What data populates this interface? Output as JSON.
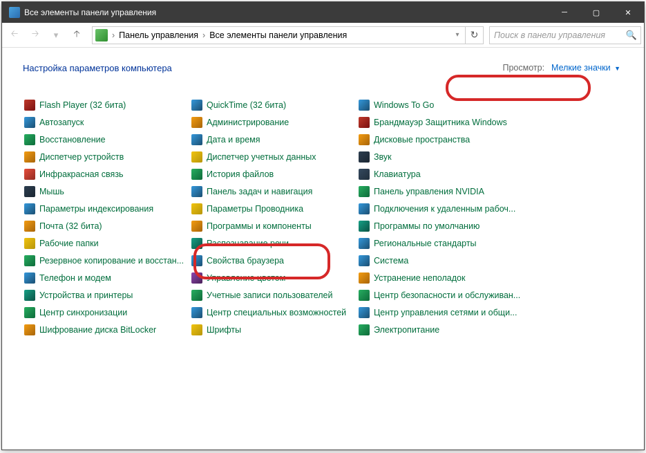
{
  "titlebar": {
    "text": "Все элементы панели управления"
  },
  "breadcrumb": {
    "root": "Панель управления",
    "current": "Все элементы панели управления"
  },
  "search": {
    "placeholder": "Поиск в панели управления"
  },
  "header": {
    "title": "Настройка параметров компьютера",
    "view_label": "Просмотр:",
    "view_value": "Мелкие значки"
  },
  "columns": [
    [
      {
        "label": "Flash Player (32 бита)",
        "icon": "flash-icon",
        "cls": "ic-a"
      },
      {
        "label": "Автозапуск",
        "icon": "autoplay-icon",
        "cls": "ic-b"
      },
      {
        "label": "Восстановление",
        "icon": "recovery-icon",
        "cls": "ic-c"
      },
      {
        "label": "Диспетчер устройств",
        "icon": "device-manager-icon",
        "cls": "ic-d"
      },
      {
        "label": "Инфракрасная связь",
        "icon": "infrared-icon",
        "cls": "ic-g"
      },
      {
        "label": "Мышь",
        "icon": "mouse-icon",
        "cls": "ic-h"
      },
      {
        "label": "Параметры индексирования",
        "icon": "indexing-icon",
        "cls": "ic-b"
      },
      {
        "label": "Почта (32 бита)",
        "icon": "mail-icon",
        "cls": "ic-d"
      },
      {
        "label": "Рабочие папки",
        "icon": "work-folders-icon",
        "cls": "ic-i"
      },
      {
        "label": "Резервное копирование и восстан...",
        "icon": "backup-icon",
        "cls": "ic-c"
      },
      {
        "label": "Телефон и модем",
        "icon": "phone-modem-icon",
        "cls": "ic-b"
      },
      {
        "label": "Устройства и принтеры",
        "icon": "devices-printers-icon",
        "cls": "ic-f"
      },
      {
        "label": "Центр синхронизации",
        "icon": "sync-center-icon",
        "cls": "ic-c"
      },
      {
        "label": "Шифрование диска BitLocker",
        "icon": "bitlocker-icon",
        "cls": "ic-d"
      }
    ],
    [
      {
        "label": "QuickTime (32 бита)",
        "icon": "quicktime-icon",
        "cls": "ic-b"
      },
      {
        "label": "Администрирование",
        "icon": "admin-tools-icon",
        "cls": "ic-d"
      },
      {
        "label": "Дата и время",
        "icon": "date-time-icon",
        "cls": "ic-b"
      },
      {
        "label": "Диспетчер учетных данных",
        "icon": "credential-manager-icon",
        "cls": "ic-i"
      },
      {
        "label": "История файлов",
        "icon": "file-history-icon",
        "cls": "ic-c"
      },
      {
        "label": "Панель задач и навигация",
        "icon": "taskbar-icon",
        "cls": "ic-b"
      },
      {
        "label": "Параметры Проводника",
        "icon": "explorer-options-icon",
        "cls": "ic-i"
      },
      {
        "label": "Программы и компоненты",
        "icon": "programs-features-icon",
        "cls": "ic-d"
      },
      {
        "label": "Распознавание речи",
        "icon": "speech-icon",
        "cls": "ic-f"
      },
      {
        "label": "Свойства браузера",
        "icon": "internet-options-icon",
        "cls": "ic-b"
      },
      {
        "label": "Управление цветом",
        "icon": "color-management-icon",
        "cls": "ic-e"
      },
      {
        "label": "Учетные записи пользователей",
        "icon": "user-accounts-icon",
        "cls": "ic-c"
      },
      {
        "label": "Центр специальных возможностей",
        "icon": "ease-of-access-icon",
        "cls": "ic-b"
      },
      {
        "label": "Шрифты",
        "icon": "fonts-icon",
        "cls": "ic-i"
      }
    ],
    [
      {
        "label": "Windows To Go",
        "icon": "windows-to-go-icon",
        "cls": "ic-b"
      },
      {
        "label": "Брандмауэр Защитника Windows",
        "icon": "firewall-icon",
        "cls": "ic-a"
      },
      {
        "label": "Дисковые пространства",
        "icon": "storage-spaces-icon",
        "cls": "ic-d"
      },
      {
        "label": "Звук",
        "icon": "sound-icon",
        "cls": "ic-h"
      },
      {
        "label": "Клавиатура",
        "icon": "keyboard-icon",
        "cls": "ic-k"
      },
      {
        "label": "Панель управления NVIDIA",
        "icon": "nvidia-icon",
        "cls": "ic-c"
      },
      {
        "label": "Подключения к удаленным рабоч...",
        "icon": "remote-desktop-icon",
        "cls": "ic-b"
      },
      {
        "label": "Программы по умолчанию",
        "icon": "default-programs-icon",
        "cls": "ic-f"
      },
      {
        "label": "Региональные стандарты",
        "icon": "region-icon",
        "cls": "ic-b"
      },
      {
        "label": "Система",
        "icon": "system-icon",
        "cls": "ic-b"
      },
      {
        "label": "Устранение неполадок",
        "icon": "troubleshooting-icon",
        "cls": "ic-d"
      },
      {
        "label": "Центр безопасности и обслуживан...",
        "icon": "security-maintenance-icon",
        "cls": "ic-c"
      },
      {
        "label": "Центр управления сетями и общи...",
        "icon": "network-sharing-icon",
        "cls": "ic-b"
      },
      {
        "label": "Электропитание",
        "icon": "power-options-icon",
        "cls": "ic-c"
      }
    ]
  ]
}
